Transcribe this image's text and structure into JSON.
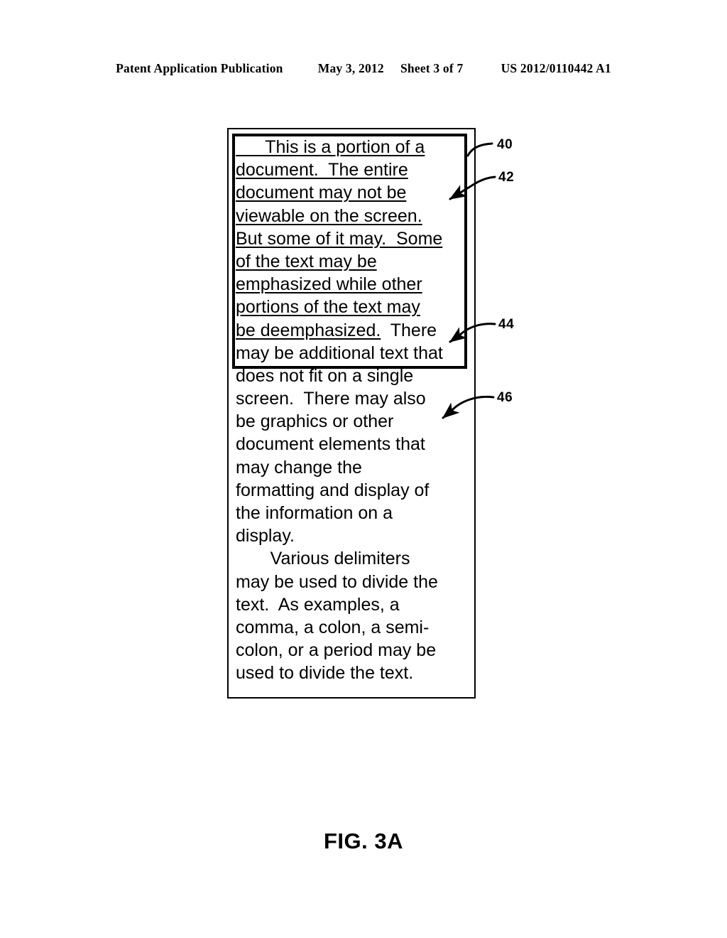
{
  "header": {
    "publication_label": "Patent Application Publication",
    "date": "May 3, 2012",
    "sheet": "Sheet 3 of 7",
    "publication_number": "US 2012/0110442 A1"
  },
  "figure": {
    "caption": "FIG. 3A",
    "document_lines": [
      {
        "text": "      This is a portion of a",
        "underlined": true
      },
      {
        "text": "document.  The entire",
        "underlined": true
      },
      {
        "text": "document may not be",
        "underlined": true
      },
      {
        "text": "viewable on the screen.",
        "underlined": true
      },
      {
        "text": "But some of it may.  Some",
        "underlined": true
      },
      {
        "text": "of the text may be",
        "underlined": true
      },
      {
        "text": "emphasized while other",
        "underlined": true
      },
      {
        "text": "portions of the text may",
        "underlined": true
      },
      {
        "text": "be deemphasized.",
        "underlined": true,
        "trailing_text": "  There"
      },
      {
        "text": "may be additional text that",
        "underlined": false
      },
      {
        "text": "does not fit on a single",
        "underlined": false
      },
      {
        "text": "screen.  There may also",
        "underlined": false
      },
      {
        "text": "be graphics or other",
        "underlined": false
      },
      {
        "text": "document elements that",
        "underlined": false
      },
      {
        "text": "may change the",
        "underlined": false
      },
      {
        "text": "formatting and display of",
        "underlined": false
      },
      {
        "text": "the information on a",
        "underlined": false
      },
      {
        "text": "display.",
        "underlined": false
      },
      {
        "text": "       Various delimiters",
        "underlined": false
      },
      {
        "text": "may be used to divide the",
        "underlined": false
      },
      {
        "text": "text.  As examples, a",
        "underlined": false
      },
      {
        "text": "comma, a colon, a semi-",
        "underlined": false
      },
      {
        "text": "colon, or a period may be",
        "underlined": false
      },
      {
        "text": "used to divide the text.",
        "underlined": false
      }
    ],
    "reference_numerals": [
      {
        "id": "40",
        "label": "40"
      },
      {
        "id": "42",
        "label": "42"
      },
      {
        "id": "44",
        "label": "44"
      },
      {
        "id": "46",
        "label": "46"
      }
    ]
  }
}
